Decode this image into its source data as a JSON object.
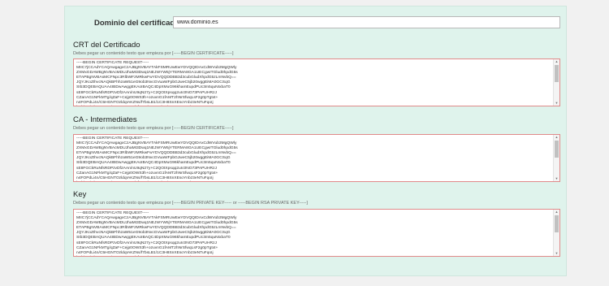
{
  "domain": {
    "label": "Dominio del certificado",
    "value": "www.dominio.es"
  },
  "sections": [
    {
      "title": "CRT del Certificado",
      "hint": "Debes pegar un contenido texto que empieza por [-----BEGIN CERTIFICATE-----]",
      "content": "-----BEGIN CERTIFICATE REQUEST-----\nMIIC7jCCAdYCAQAwgagxCzAJBgNVBAYTAkFSMRUwEwYDVQQIDAxCdWVub3MgQWly\nZXMxGDAWBgNVBAcMDUJhaMI3Dwq1NEJWYW5jYTERMA8GA1UECgwITGlud0hpdG5s\nETAPBgNVBAsMCFNpc3RlbWFzMRkwFwYDVQQDDBB3d3cubGludXhpdG5zLmNvbQ==\nJQYJKoZIhvcNAQkBFhhzaW51eG9ob3NvcGVuaWFpbGJweC5jb20wggEiMA0GCSqG\nSIb3DQEBAQUAA4IBDwAwggEKAoIBAQC4DpXMuG96khamEupdPUc3m5quNIxbaT0\nsE8FGCkRuNfsRDPzvDf2AAn/nU9qN27y+C2QOtXpsqq2uIc0NO73PAPUHRzJ\nCZanAG1NFkMTg/qZaF+Cejp0OWS3h+ozuvnG1fAMT2hNrSfwqLsF2g0pTgtxt+\nn4FOPdLi4n/C5HGNTOzldqIAKZNs/f7bsLB1/1C3H8SnXEsoYnbz3eNTuFqoIj\nbNhjzmiGbN72zyv6jYPG4mSSC/pfgCG/zF+AFdGqiWNOpnFvC/BOKLN2pIuzKy"
    },
    {
      "title": "CA - Intermediates",
      "hint": "Debes pegar un contenido texto que empieza por [-----BEGIN CERTIFICATE-----]",
      "content": "-----BEGIN CERTIFICATE REQUEST-----\nMIIC7jCCAdYCAQAwgagxCzAJBgNVBAYTAkFSMRUwEwYDVQQIDAxCdWVub3MgQWly\nZXMxGDAWBgNVBAcMDUJhaMI3Dwq1NEJWYW5jYTERMA8GA1UECgwITGlud0hpdG5s\nETAPBgNVBAsMCFNpc3RlbWFzMRkwFwYDVQQDDBB3d3cubGludXhpdG5zLmNvbQ==\nJQYJKoZIhvcNAQkBFhhzaW51eG9ob3NvcGVuaWFpbGJweC5jb20wggEiMA0GCSqG\nSIb3DQEBAQUAA4IBDwAwggEKAoIBAQC4DpXMuG96khamEupdPUc3m5quNIxbaT0\nsE8FGCkRuNfsRDPzvDf2AAn/nU9qN27y+C2QOtXpsqq2uIc0NO73PAPUHRzJ\nCZanAG1NFkMTg/qZaF+Cejp0OWS3h+ozuvnG1fAMT2hNrSfwqLsF2g0pTgtxt+\nn4FOPdLi4n/C5HGNTOzldqIAKZNs/f7bsLB1/1C3H8SnXEsoYnbz3eNTuFqoIj\nbNhjzmiGbN72zyv6jYPG4mSSC/pfgCG/zF+AFdGqiWNOpnFvC/BOKLN2pIuzKy"
    },
    {
      "title": "Key",
      "hint": "Debes pegar un contenido texto que empieza por [-----BEGIN PRIVATE KEY----- or -----BEGIN RSA PRIVATE KEY-----]",
      "content": "-----BEGIN CERTIFICATE REQUEST-----\nMIIC7jCCAdYCAQAwgagxCzAJBgNVBAYTAkFSMRUwEwYDVQQIDAxCdWVub3MgQWly\nZXMxGDAWBgNVBAcMDUJhaMI3Dwq1NEJWYW5jYTERMA8GA1UECgwITGlud0hpdG5s\nETAPBgNVBAsMCFNpc3RlbWFzMRkwFwYDVQQDDBB3d3cubGludXhpdG5zLmNvbQ==\nJQYJKoZIhvcNAQkBFhhzaW51eG9ob3NvcGVuaWFpbGJweC5jb20wggEiMA0GCSqG\nSIb3DQEBAQUAA4IBDwAwggEKAoIBAQC4DpXMuG96khamEupdPUc3m5quNIxbaT0\nsE8FGCkRuNfsRDPzvDf2AAn/nU9qN27y+C2QOtXpsqq2uIc0NO73PAPUHRzJ\nCZanAG1NFkMTg/qZaF+Cejp0OWS3h+ozuvnG1fAMT2hNrSfwqLsF2g0pTgtxt+\nn4FOPdLi4n/C5HGNTOzldqIAKZNs/f7bsLB1/1C3H8SnXEsoYnbz3eNTuFqoIj\nbNhjzmiGbN72zyv6jYPG4mSSC/pfgCG/zF+AFdGqiWNOpnFvC/BOKLN2pIuzKy"
    }
  ],
  "icons": {
    "scroll_up": "scroll-up-arrow-icon",
    "scroll_down": "scroll-down-arrow-icon"
  },
  "colors": {
    "panel_bg": "#dff3ec",
    "textarea_border": "#e08a8a",
    "page_bg": "#f1f1f1"
  }
}
